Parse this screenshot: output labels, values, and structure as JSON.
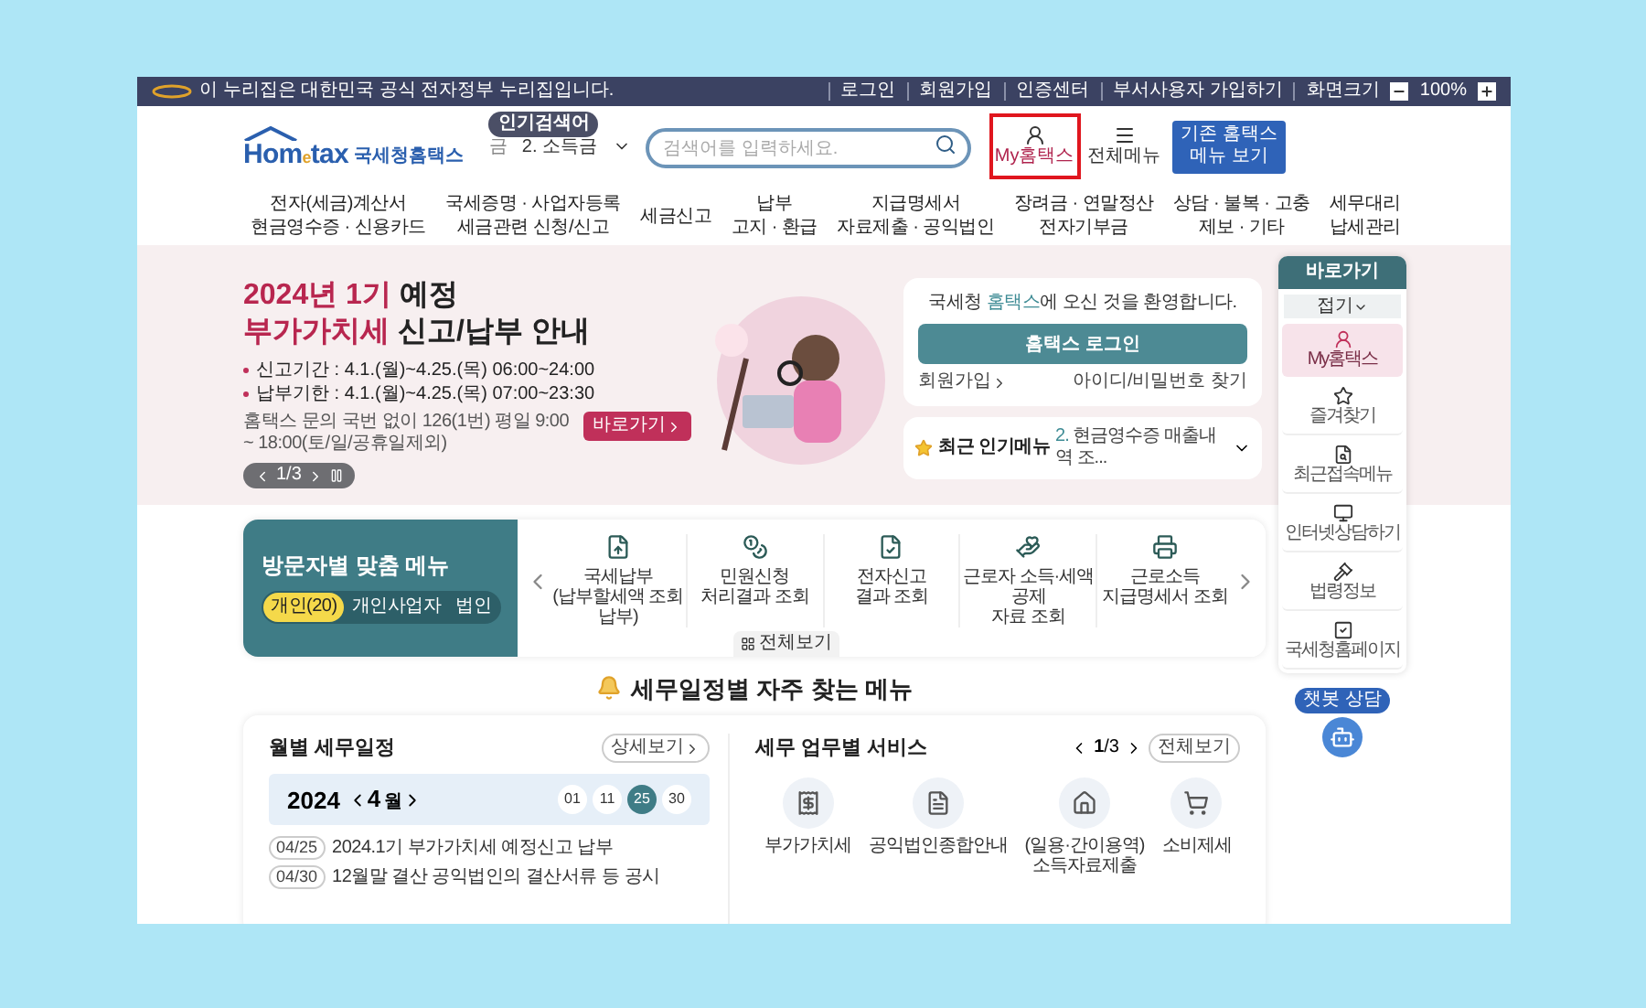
{
  "notice_bar": {
    "text": "이 누리집은 대한민국 공식 전자정부 누리집입니다.",
    "links": [
      "로그인",
      "회원가입",
      "인증센터",
      "부서사용자 가입하기"
    ],
    "zoom_label": "화면크기",
    "zoom_value": "100%"
  },
  "header": {
    "logo": {
      "parts": [
        "Hom",
        "e",
        "tax"
      ],
      "brand": "국세청홈택스"
    },
    "popular_badge": "인기검색어",
    "popular_items": [
      "금",
      "2. 소득금"
    ],
    "search": {
      "placeholder": "검색어를 입력하세요."
    },
    "my_hometax": {
      "label": "My홈택스",
      "highlighted": true
    },
    "all_menu": "전체메뉴",
    "old_menu": [
      "기존 홈택스",
      "메뉴 보기"
    ]
  },
  "nav": [
    {
      "lines": [
        "전자(세금)계산서",
        "현금영수증 · 신용카드"
      ]
    },
    {
      "lines": [
        "국세증명 · 사업자등록",
        "세금관련 신청/신고"
      ]
    },
    {
      "lines": [
        "세금신고"
      ]
    },
    {
      "lines": [
        "납부",
        "고지 · 환급"
      ]
    },
    {
      "lines": [
        "지급명세서",
        "자료제출 · 공익법인"
      ]
    },
    {
      "lines": [
        "장려금 · 연말정산",
        "전자기부금"
      ]
    },
    {
      "lines": [
        "상담 · 불복 · 고충",
        "제보 · 기타"
      ]
    },
    {
      "lines": [
        "세무대리",
        "납세관리"
      ]
    }
  ],
  "hero": {
    "title_lines": [
      {
        "accent": "2024년 1기",
        "text": "예정"
      },
      {
        "accent": "부가가치세",
        "text": "신고/납부 안내"
      }
    ],
    "details": [
      "신고기간 : 4.1.(월)~4.25.(목) 06:00~24:00",
      "납부기한 : 4.1.(월)~4.25.(목) 07:00~23:30"
    ],
    "note": "홈택스 문의 국번 없이 126(1번) 평일 9:00 ~ 18:00(토/일/공휴일제외)",
    "button": "바로가기",
    "pager": "1/3"
  },
  "login_card": {
    "welcome": {
      "before": "국세청 ",
      "accent": "홈택스",
      "after": "에 오신 것을 환영합니다."
    },
    "button": "홈택스 로그인",
    "links": [
      "회원가입",
      "아이디/비밀번호 찾기"
    ]
  },
  "popular_menu": {
    "label": "최근 인기메뉴",
    "item_number": "2.",
    "item": "현금영수증 매출내역 조..."
  },
  "quick_menu": {
    "title": "바로가기",
    "collapse": "접기",
    "items": [
      {
        "label": "My홈택스",
        "selected": true,
        "kind": "user"
      },
      {
        "label": "즐겨찾기",
        "selected": false,
        "kind": "star"
      },
      {
        "label": "최근접속메뉴",
        "selected": false,
        "kind": "recent"
      },
      {
        "label": "인터넷상담하기",
        "selected": false,
        "kind": "monitor"
      },
      {
        "label": "법령정보",
        "selected": false,
        "kind": "gavel"
      },
      {
        "label": "국세청홈페이지",
        "selected": false,
        "kind": "check"
      }
    ],
    "chatbot": "챗봇 상담"
  },
  "visitor_menu": {
    "title": "방문자별 맞춤 메뉴",
    "tabs": [
      {
        "label": "개인(20)",
        "selected": true
      },
      {
        "label": "개인사업자",
        "selected": false
      },
      {
        "label": "법인",
        "selected": false
      }
    ],
    "items": [
      {
        "lines": [
          "국세납부",
          "(납부할세액 조회납부)"
        ]
      },
      {
        "lines": [
          "민원신청",
          "처리결과 조회"
        ]
      },
      {
        "lines": [
          "전자신고",
          "결과 조회"
        ]
      },
      {
        "lines": [
          "근로자 소득·세액공제",
          "자료 조회"
        ]
      },
      {
        "lines": [
          "근로소득",
          "지급명세서 조회"
        ]
      }
    ],
    "view_all": "전체보기"
  },
  "section_title": "세무일정별 자주 찾는 메뉴",
  "schedule": {
    "title": "월별 세무일정",
    "detail": "상세보기",
    "year": "2024",
    "month": "4",
    "month_unit": "월",
    "days": [
      {
        "label": "01",
        "selected": false
      },
      {
        "label": "11",
        "selected": false
      },
      {
        "label": "25",
        "selected": true
      },
      {
        "label": "30",
        "selected": false
      }
    ],
    "events": [
      {
        "date": "04/25",
        "text": "2024.1기 부가가치세 예정신고 납부"
      },
      {
        "date": "04/30",
        "text": "12월말 결산 공익법인의 결산서류 등 공시"
      }
    ]
  },
  "services": {
    "title": "세무 업무별 서비스",
    "pager_current": "1",
    "pager_total": "/3",
    "view_all": "전체보기",
    "items": [
      {
        "lines": [
          "부가가치세"
        ]
      },
      {
        "lines": [
          "공익법인종합안내"
        ]
      },
      {
        "lines": [
          "(일용·간이용역)",
          "소득자료제출"
        ]
      },
      {
        "lines": [
          "소비제세"
        ]
      }
    ]
  }
}
